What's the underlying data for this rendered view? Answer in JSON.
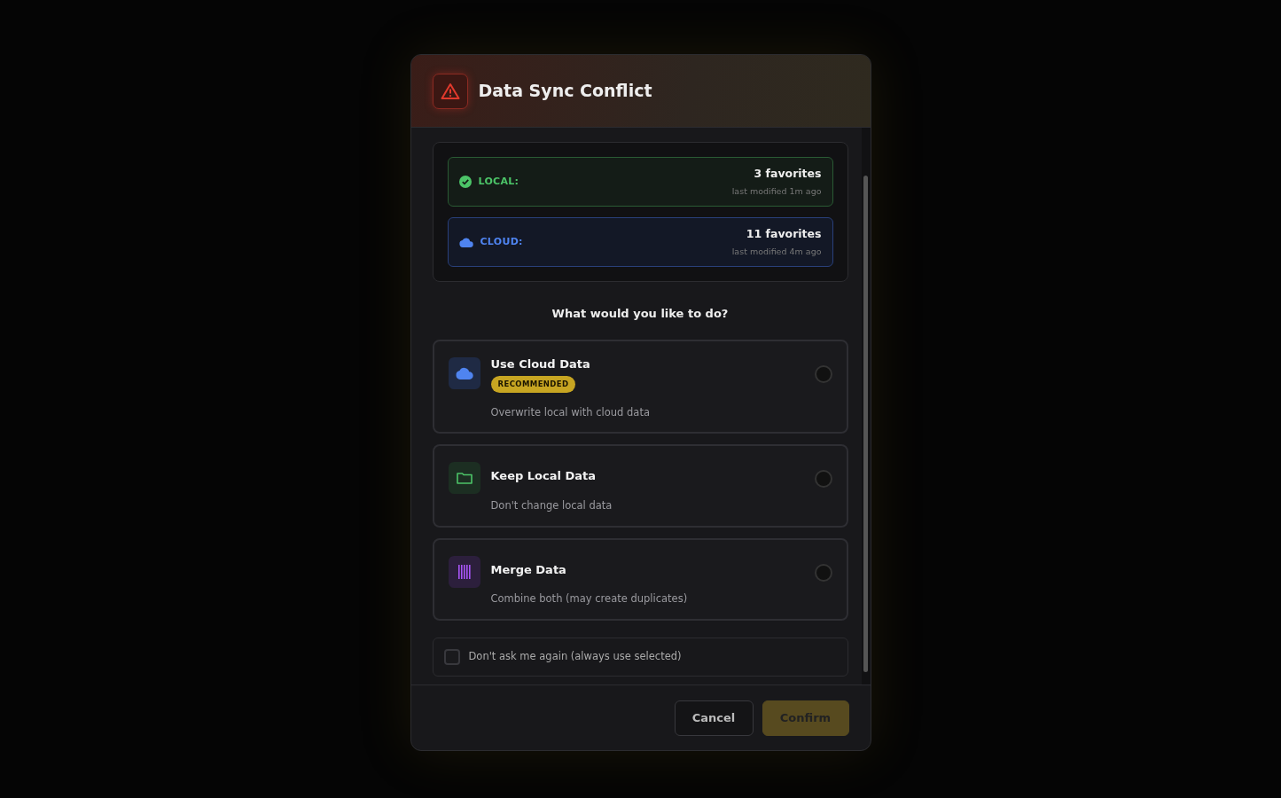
{
  "dialog": {
    "title": "Data Sync Conflict",
    "sources": [
      {
        "kind": "local",
        "label": "LOCAL:",
        "count": "3 favorites",
        "modified": "last modified 1m ago"
      },
      {
        "kind": "cloud",
        "label": "CLOUD:",
        "count": "11 favorites",
        "modified": "last modified 4m ago"
      }
    ],
    "question": "What would you like to do?",
    "options": [
      {
        "kind": "cloud",
        "title": "Use Cloud Data",
        "badge": "RECOMMENDED",
        "description": "Overwrite local with cloud data",
        "selected": false
      },
      {
        "kind": "local",
        "title": "Keep Local Data",
        "description": "Don't change local data",
        "selected": false
      },
      {
        "kind": "merge",
        "title": "Merge Data",
        "description": "Combine both (may create duplicates)",
        "selected": false
      }
    ],
    "remember": {
      "label": "Don't ask me again (always use selected)",
      "checked": false
    },
    "buttons": [
      {
        "kind": "secondary",
        "label": "Cancel",
        "disabled": false
      },
      {
        "kind": "primary",
        "label": "Confirm",
        "disabled": true
      }
    ]
  }
}
